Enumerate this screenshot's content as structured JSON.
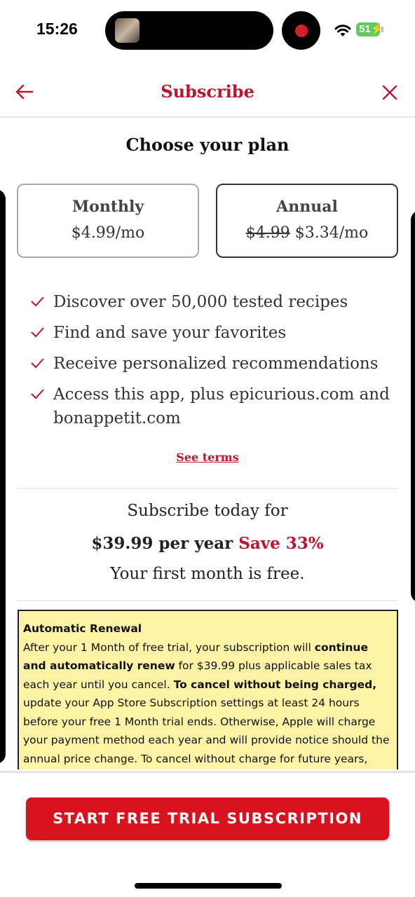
{
  "status_bar": {
    "time": "15:26",
    "battery": "51"
  },
  "header": {
    "title": "Subscribe"
  },
  "heading": "Choose your plan",
  "plans": {
    "monthly": {
      "name": "Monthly",
      "price": "$4.99/mo"
    },
    "annual": {
      "name": "Annual",
      "old_price": "$4.99",
      "price": "$3.34/mo"
    }
  },
  "features": [
    "Discover over 50,000 tested recipes",
    "Find and save your favorites",
    "Receive personalized recommendations",
    "Access this app, plus epicurious.com and bonappetit.com"
  ],
  "terms_link": "See terms",
  "summary": {
    "line1": "Subscribe today for",
    "price": "$39.99 per year",
    "save": "Save 33%",
    "line3": "Your first month is free."
  },
  "renewal": {
    "title": "Automatic Renewal",
    "p1": "After your 1 Month of free trial, your subscription will ",
    "b1": "continue and automatically renew",
    "p2": " for $39.99 plus applicable sales tax each year until you cancel. ",
    "b2": "To cancel without being charged,",
    "p3": " update your App Store Subscription settings at least 24 hours before your free 1 Month trial ends. Otherwise, Apple will charge your payment method each year and will provide notice should the annual price change. To cancel without charge for future years, update your App Store"
  },
  "cta_label": "START FREE TRIAL SUBSCRIPTION",
  "colors": {
    "accent": "#c1122f",
    "cta": "#d8121f",
    "notice_bg": "#fdf3a7"
  }
}
